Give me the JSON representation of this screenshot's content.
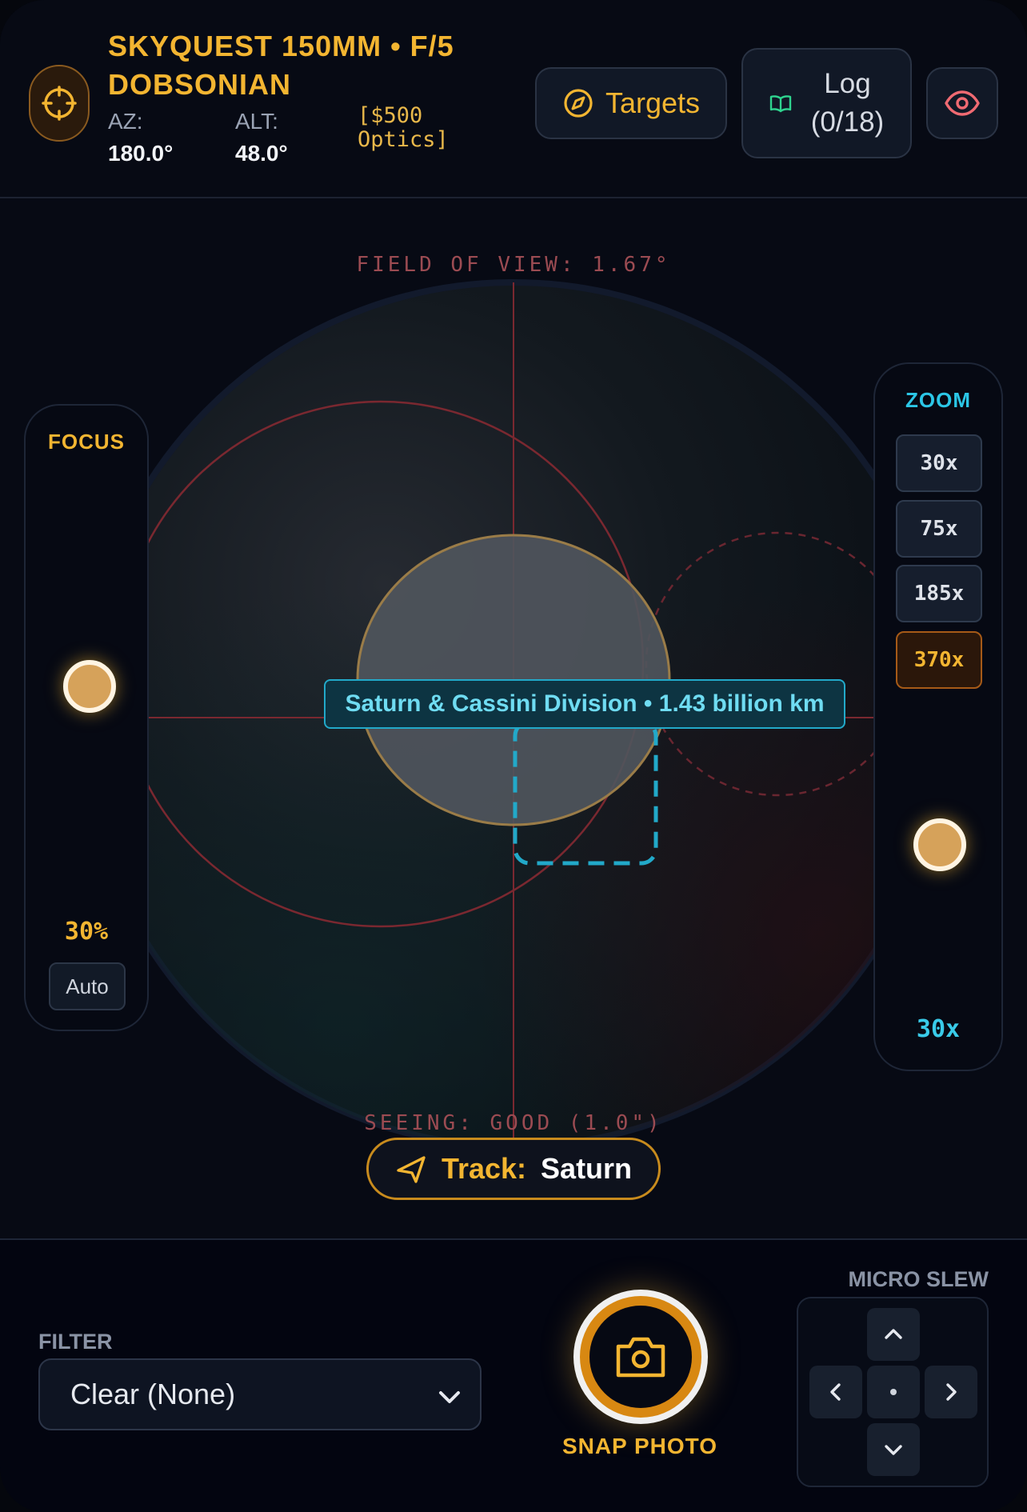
{
  "header": {
    "title": "SKYQUEST 150MM • F/5 DOBSONIAN",
    "az_label": "AZ:",
    "az_value": "180.0°",
    "alt_label": "ALT:",
    "alt_value": "48.0°",
    "optics_line1": "[$500",
    "optics_line2": "Optics]",
    "targets_label": "Targets",
    "log_line1": "Log",
    "log_line2": "(0/18)",
    "icons": [
      "crosshair-icon",
      "compass-icon",
      "book-icon",
      "eye-icon"
    ]
  },
  "viewport": {
    "fov_label": "FIELD OF VIEW: 1.67°",
    "seeing_label": "SEEING: GOOD (1.0\")",
    "target_label": "Saturn & Cassini Division • 1.43 billion km",
    "track_key": "Track:",
    "track_value": "Saturn"
  },
  "focus": {
    "title": "FOCUS",
    "value": "30%",
    "level": 0.3,
    "auto_label": "Auto"
  },
  "zoom": {
    "title": "ZOOM",
    "options": [
      "30x",
      "75x",
      "185x",
      "370x"
    ],
    "selected": "370x",
    "current": "30x"
  },
  "bottom": {
    "filter_label": "FILTER",
    "filter_value": "Clear (None)",
    "snap_label": "SNAP PHOTO",
    "slew_label": "MICRO SLEW"
  },
  "colors": {
    "accent": "#f3b531",
    "cyan": "#2bc6e6",
    "reticle": "#8c2e36",
    "background": "#070a14"
  }
}
